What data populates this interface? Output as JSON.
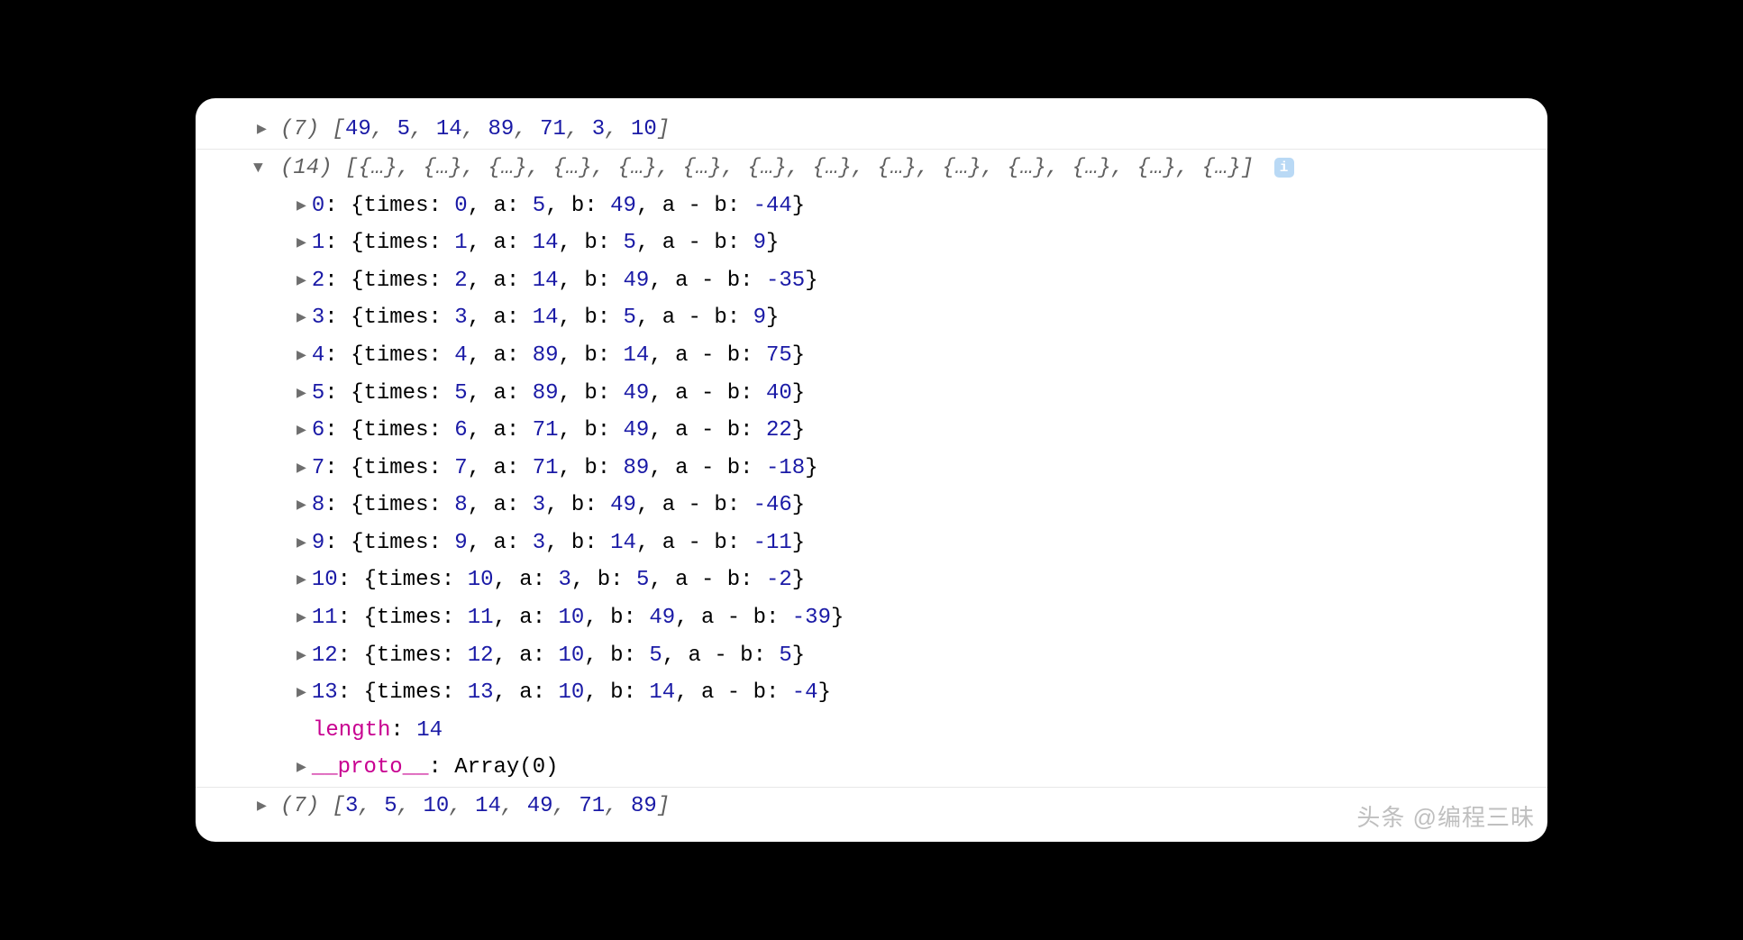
{
  "arr1": {
    "len": "7",
    "values": [
      "49",
      "5",
      "14",
      "89",
      "71",
      "3",
      "10"
    ]
  },
  "arr2": {
    "len": "14",
    "placeholder": "{…}",
    "items": [
      {
        "idx": "0",
        "times": "0",
        "a": "5",
        "b": "49",
        "ab": "-44"
      },
      {
        "idx": "1",
        "times": "1",
        "a": "14",
        "b": "5",
        "ab": "9"
      },
      {
        "idx": "2",
        "times": "2",
        "a": "14",
        "b": "49",
        "ab": "-35"
      },
      {
        "idx": "3",
        "times": "3",
        "a": "14",
        "b": "5",
        "ab": "9"
      },
      {
        "idx": "4",
        "times": "4",
        "a": "89",
        "b": "14",
        "ab": "75"
      },
      {
        "idx": "5",
        "times": "5",
        "a": "89",
        "b": "49",
        "ab": "40"
      },
      {
        "idx": "6",
        "times": "6",
        "a": "71",
        "b": "49",
        "ab": "22"
      },
      {
        "idx": "7",
        "times": "7",
        "a": "71",
        "b": "89",
        "ab": "-18"
      },
      {
        "idx": "8",
        "times": "8",
        "a": "3",
        "b": "49",
        "ab": "-46"
      },
      {
        "idx": "9",
        "times": "9",
        "a": "3",
        "b": "14",
        "ab": "-11"
      },
      {
        "idx": "10",
        "times": "10",
        "a": "3",
        "b": "5",
        "ab": "-2"
      },
      {
        "idx": "11",
        "times": "11",
        "a": "10",
        "b": "49",
        "ab": "-39"
      },
      {
        "idx": "12",
        "times": "12",
        "a": "10",
        "b": "5",
        "ab": "5"
      },
      {
        "idx": "13",
        "times": "13",
        "a": "10",
        "b": "14",
        "ab": "-4"
      }
    ],
    "length_label": "length",
    "length_value": "14",
    "proto_label": "__proto__",
    "proto_value": "Array(0)"
  },
  "arr3": {
    "len": "7",
    "values": [
      "3",
      "5",
      "10",
      "14",
      "49",
      "71",
      "89"
    ]
  },
  "labels": {
    "times": "times",
    "a": "a",
    "b": "b",
    "ab": "a - b",
    "info_badge": "i"
  },
  "watermark": "头条 @编程三昧"
}
